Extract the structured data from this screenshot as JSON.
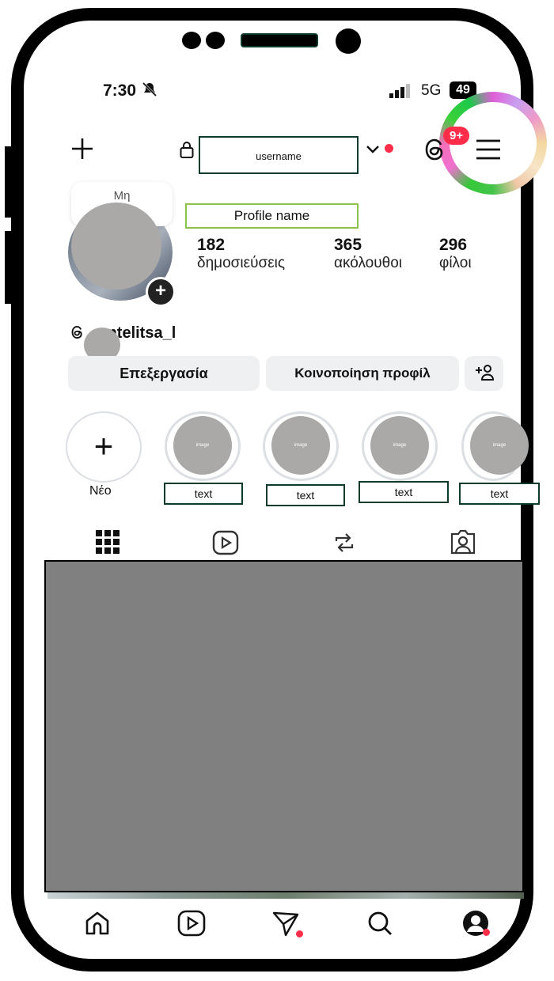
{
  "status_bar": {
    "time": "7:30",
    "network": "5G",
    "battery": "49"
  },
  "header": {
    "username": "username",
    "notif_badge": "9+"
  },
  "profile": {
    "note_text": "Μη\nδ...",
    "name": "Profile name",
    "stats": [
      {
        "num": "182",
        "label": "δημοσιεύσεις"
      },
      {
        "num": "365",
        "label": "ακόλουθοι"
      },
      {
        "num": "296",
        "label": "φίλοι"
      }
    ],
    "threads_handle": "ntelitsa_l"
  },
  "actions": {
    "edit": "Επεξεργασία",
    "share": "Κοινοποίηση προφίλ"
  },
  "highlights": {
    "new_label": "Νέο",
    "items": [
      {
        "image": "image",
        "label": "text"
      },
      {
        "image": "image",
        "label": "text"
      },
      {
        "image": "image",
        "label": "text"
      },
      {
        "image": "image",
        "label": "text"
      }
    ]
  },
  "colors": {
    "accent_red": "#ff2d4a",
    "box_green": "#0c3b2a",
    "name_box_green": "#8bc34a",
    "placeholder_gray": "#aba9a8",
    "grid_gray": "#808080"
  },
  "icons": [
    "plus-icon",
    "lock-icon",
    "chevron-down-icon",
    "threads-icon",
    "menu-icon",
    "grid-icon",
    "reels-icon",
    "repost-icon",
    "tagged-icon",
    "home-icon",
    "send-icon",
    "search-icon",
    "profile-icon",
    "add-person-icon"
  ]
}
